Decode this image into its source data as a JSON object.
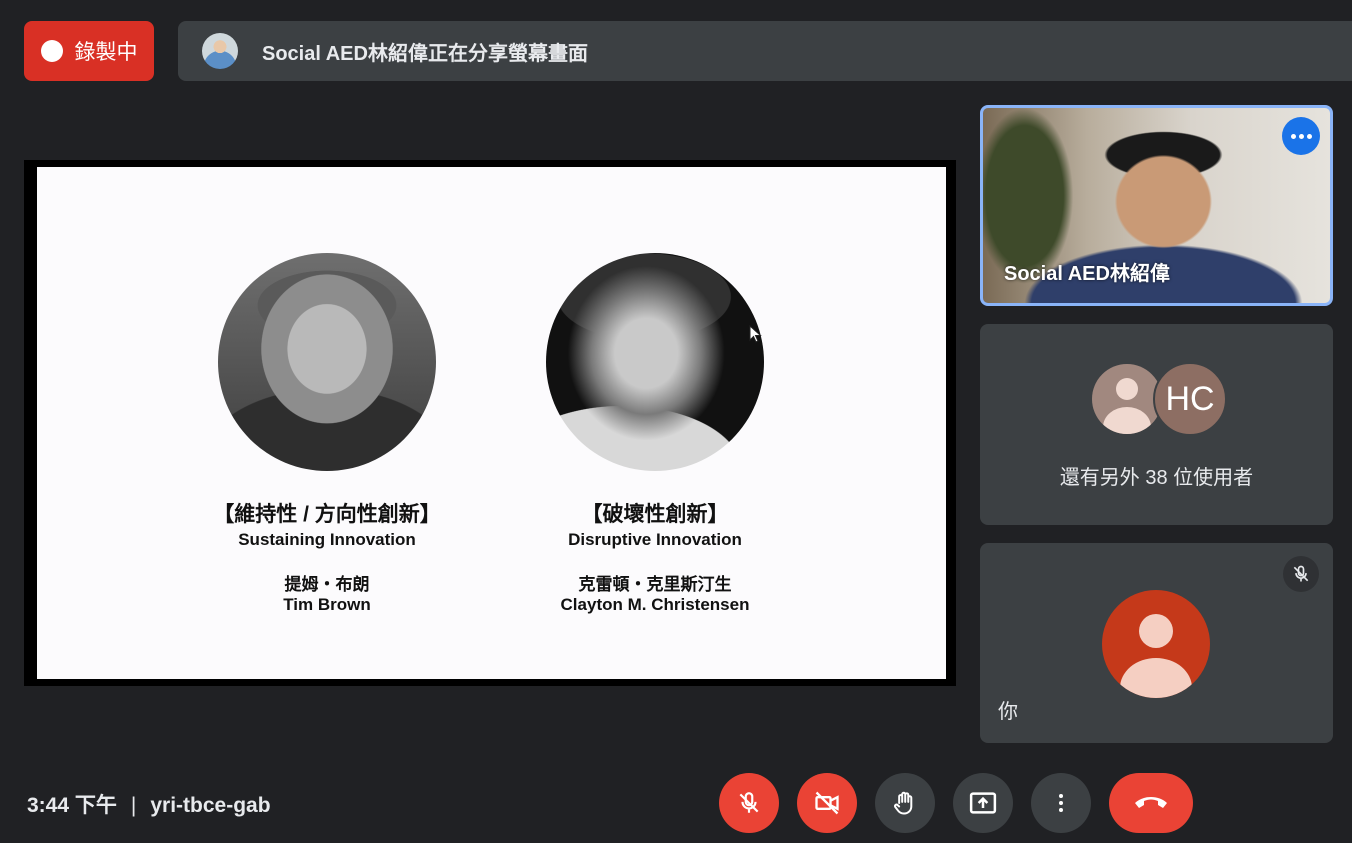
{
  "recording": {
    "label": "錄製中"
  },
  "presenting_banner": {
    "text": "Social AED林紹偉正在分享螢幕畫面"
  },
  "slide": {
    "left": {
      "title_cn": "【維持性 / 方向性創新】",
      "title_en": "Sustaining Innovation",
      "name_cn": "提姆・布朗",
      "name_en": "Tim Brown"
    },
    "right": {
      "title_cn": "【破壞性創新】",
      "title_en": "Disruptive Innovation",
      "name_cn": "克雷頓・克里斯汀生",
      "name_en": "Clayton M. Christensen"
    }
  },
  "participants": {
    "main": {
      "name": "Social AED林紹偉"
    },
    "others": {
      "initials": "HC",
      "text": "還有另外 38 位使用者"
    },
    "self": {
      "label": "你"
    }
  },
  "bottom_bar": {
    "time": "3:44 下午",
    "meeting_code": "yri-tbce-gab"
  },
  "colors": {
    "background": "#202124",
    "tile": "#3c4043",
    "recording_red": "#d93025",
    "control_red": "#ea4335",
    "active_speaker_border": "#8ab4f8",
    "menu_blue": "#1a73e8"
  },
  "icons": {
    "mic": "mic-off-icon",
    "camera": "camera-off-icon",
    "hand": "raise-hand-icon",
    "present": "present-screen-icon",
    "more": "more-vert-icon",
    "hangup": "hangup-icon"
  }
}
